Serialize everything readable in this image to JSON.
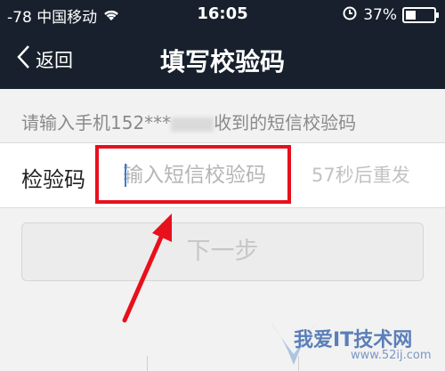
{
  "status_bar": {
    "signal": "-78",
    "carrier": "中国移动",
    "time": "16:05",
    "battery_percent": "37%",
    "battery_level": 0.37
  },
  "navbar": {
    "back_label": "返回",
    "title": "填写校验码"
  },
  "hint": "请输入手机152***",
  "hint_suffix": "收到的短信校验码",
  "code_row": {
    "label": "检验码",
    "placeholder": "输入短信校验码",
    "resend": "57秒后重发"
  },
  "next_button": "下一步",
  "watermark": {
    "text": "我爱IT技术网",
    "url": "www.52ij.com"
  },
  "colors": {
    "nav_bg": "#17202c",
    "highlight": "#e8101c",
    "cursor": "#3a7bd5"
  }
}
